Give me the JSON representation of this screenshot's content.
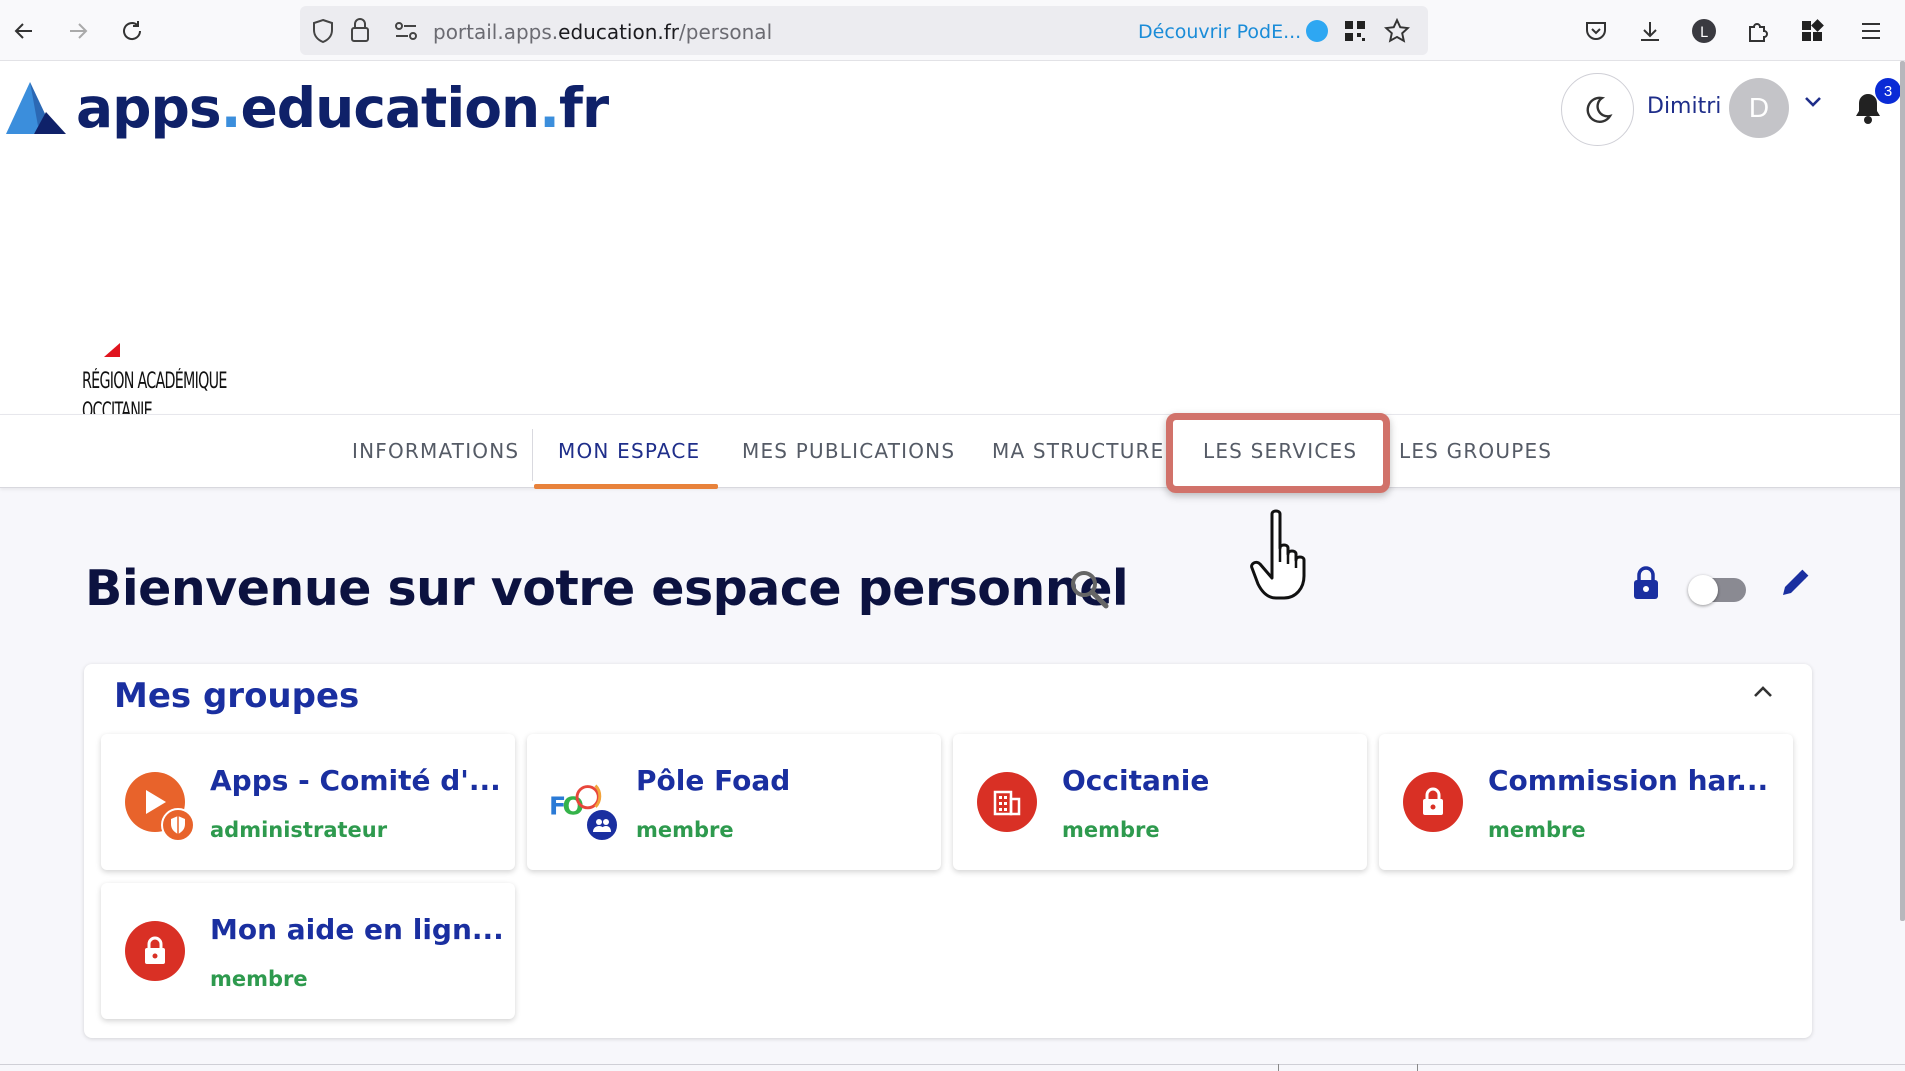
{
  "browser": {
    "url_prefix": "portail.apps.",
    "url_domain": "education.fr",
    "url_path": "/personal",
    "podeduc_label": "Découvrir PodE..."
  },
  "header": {
    "logo_part1": "apps",
    "logo_part2": "education",
    "logo_part3": "fr",
    "user_name": "Dimitri",
    "avatar_initial": "D",
    "notification_count": "3",
    "region_line1": "RÉGION ACADÉMIQUE",
    "region_line2": "OCCITANIE"
  },
  "tabs": [
    {
      "label": "INFORMATIONS"
    },
    {
      "label": "MON ESPACE"
    },
    {
      "label": "MES PUBLICATIONS"
    },
    {
      "label": "MA STRUCTURE"
    },
    {
      "label": "LES SERVICES"
    },
    {
      "label": "LES GROUPES"
    }
  ],
  "main": {
    "title": "Bienvenue sur votre espace personnel"
  },
  "groups": {
    "title": "Mes groupes",
    "items": [
      {
        "name": "Apps - Comité d'...",
        "role": "administrateur",
        "icon": "play-icon",
        "color": "#e8632b"
      },
      {
        "name": "Pôle Foad",
        "role": "membre",
        "icon": "foad-logo",
        "color": "#1a2fa0"
      },
      {
        "name": "Occitanie",
        "role": "membre",
        "icon": "building-icon",
        "color": "#d93025"
      },
      {
        "name": "Commission har...",
        "role": "membre",
        "icon": "lock-icon",
        "color": "#d93025"
      },
      {
        "name": "Mon aide en lign...",
        "role": "membre",
        "icon": "lock-icon",
        "color": "#d93025"
      }
    ]
  },
  "colors": {
    "accent": "#1a2fa0",
    "tab_underline": "#e8823b",
    "role_green": "#2e9a4e",
    "highlight": "#d1726a"
  }
}
